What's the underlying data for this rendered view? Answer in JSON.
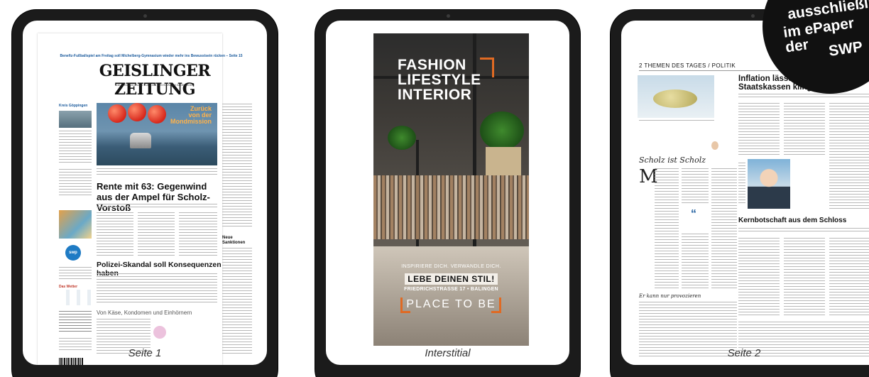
{
  "tablets": [
    {
      "caption": "Seite 1"
    },
    {
      "caption": "Interstitial"
    },
    {
      "caption": "Seite 2"
    }
  ],
  "page1": {
    "teaser": "Benefiz-Fußballspiel am Freitag soll Michelberg-Gymnasium wieder mehr ins Bewusstsein rücken – Seite 15",
    "masthead": "GEISLINGER ZEITUNG",
    "subtitle": "DIE TAGESZEITUNG FÜR DEN GROSSRAUM GEISLINGEN",
    "local_label": "Kreis Göppingen",
    "photo_headline": [
      "Zurück",
      "von der",
      "Mondmission"
    ],
    "lead_headline": "Rente mit 63: Gegenwind aus der Ampel für Scholz-Vorstoß",
    "second_headline": "Polizei-Skandal soll Konsequenzen haben",
    "third_headline": "Von Käse, Kondomen und Einhörnern",
    "right_teaser": [
      "Neue",
      "Sanktionen"
    ],
    "swp_logo": "swp",
    "weather_label": "Das Wetter"
  },
  "interstitial": {
    "headline": [
      "FASHION",
      "LIFESTYLE",
      "INTERIOR"
    ],
    "tagline": "INSPIRIERE DICH. VERWANDLE DICH.",
    "slogan": "LEBE DEINEN STIL!",
    "address": "FRIEDRICHSTRASSE 17 • BALINGEN",
    "claim": "PLACE TO BE",
    "accent_color": "#e06a23"
  },
  "page2": {
    "section": "2  THEMEN DES TAGES / POLITIK",
    "lead_headline": "Inflation lässt die Staatskassen klingeln",
    "commentary_title": "Scholz ist Scholz",
    "commentary_title_2": "Er kann nur provozieren",
    "second_headline": "Kernbotschaft aus dem Schloss"
  },
  "badge": {
    "lines": [
      "ausschließlich",
      "im ePaper der",
      "SWP"
    ]
  }
}
